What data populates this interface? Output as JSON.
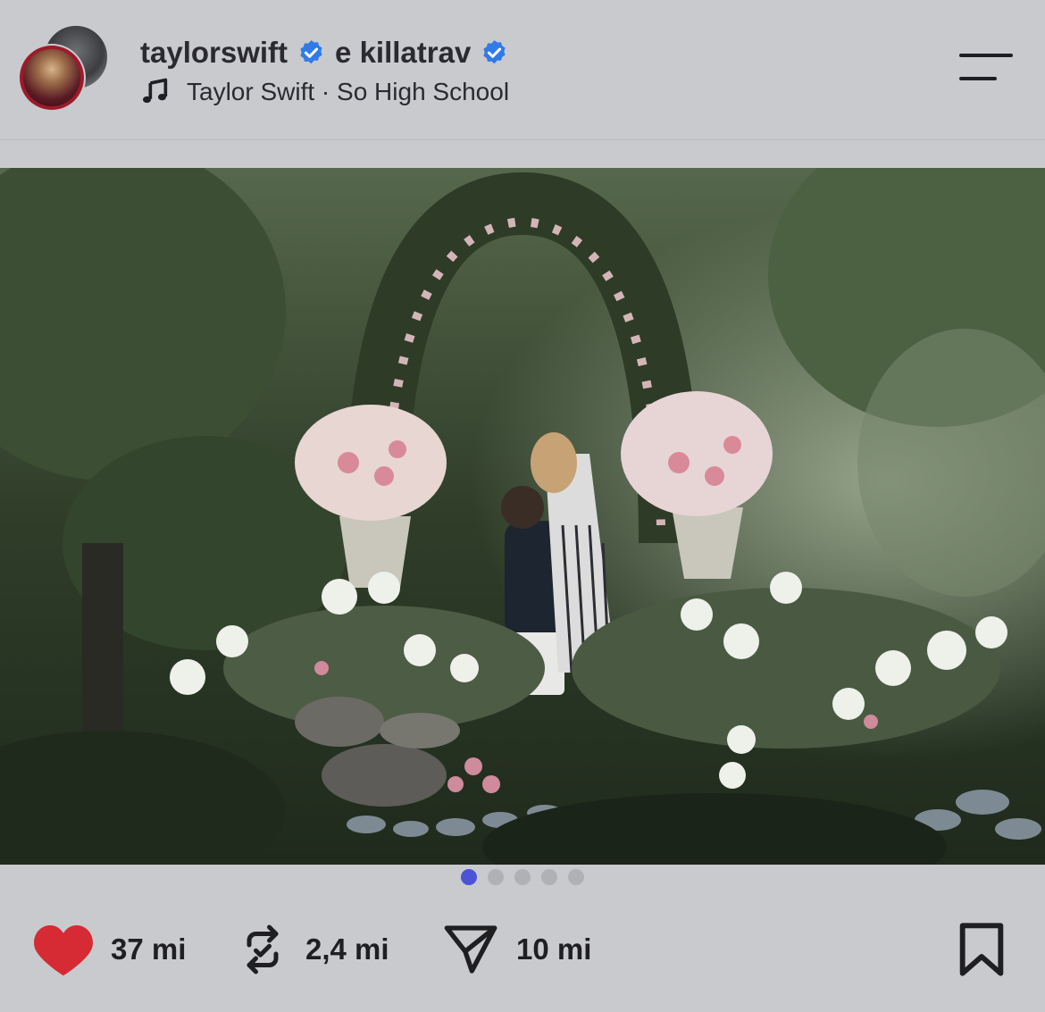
{
  "header": {
    "user1": "taylorswift",
    "user2": "e killatrav",
    "song": "Taylor Swift · So High School"
  },
  "actions": {
    "likes": "37 mi",
    "reposts": "2,4 mi",
    "shares": "10 mi"
  },
  "carousel": {
    "total": 5,
    "active": 1
  },
  "colors": {
    "like": "#d62a35",
    "verified": "#2f7be8",
    "active_dot": "#4b54d6"
  },
  "icons": [
    "heart-icon",
    "repost-icon",
    "share-icon",
    "bookmark-icon",
    "music-note-icon",
    "verified-badge-icon",
    "menu-icon"
  ]
}
